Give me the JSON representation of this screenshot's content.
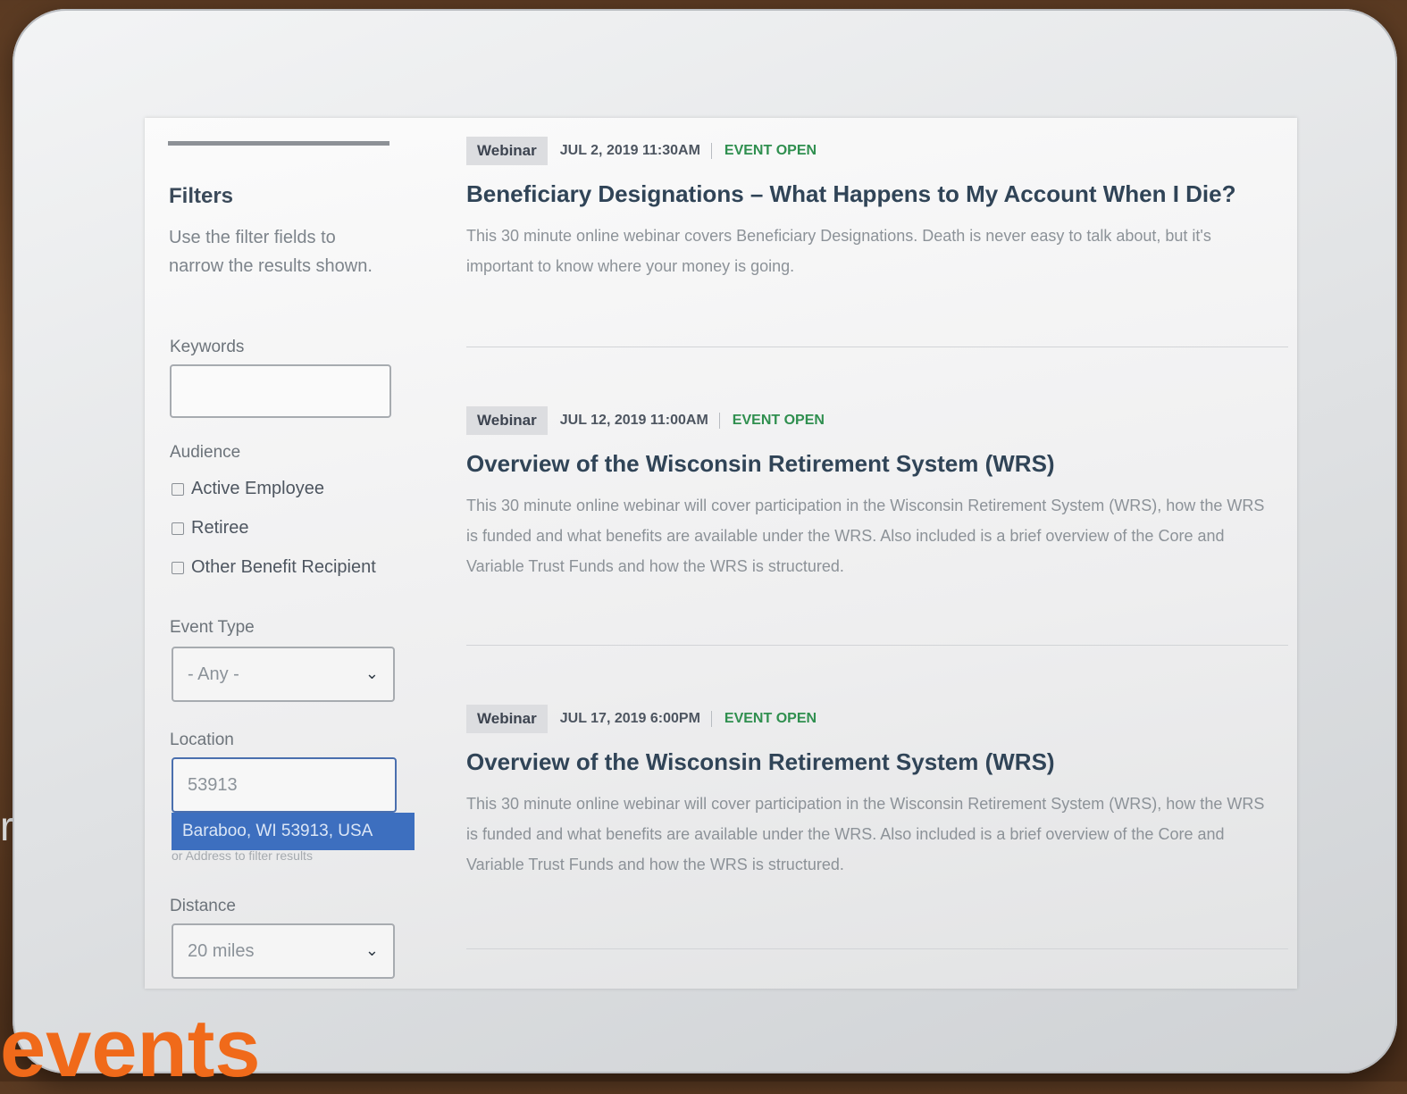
{
  "background": {
    "fragment_small": "rs",
    "fragment_large": "events",
    "accent_color": "#f06a1a"
  },
  "sidebar": {
    "title": "Filters",
    "description": "Use the filter fields to narrow the results shown.",
    "keywords": {
      "label": "Keywords",
      "value": ""
    },
    "audience": {
      "label": "Audience",
      "options": [
        "Active Employee",
        "Retiree",
        "Other Benefit Recipient"
      ]
    },
    "event_type": {
      "label": "Event Type",
      "selected": "- Any -"
    },
    "location": {
      "label": "Location",
      "value": "53913",
      "suggestion": "Baraboo, WI 53913, USA",
      "hint": "or Address to filter results"
    },
    "distance": {
      "label": "Distance",
      "selected": "20 miles"
    }
  },
  "events": [
    {
      "type": "Webinar",
      "date": "JUL 2, 2019 11:30AM",
      "status": "EVENT OPEN",
      "title": "Beneficiary Designations – What Happens to My Account When I Die?",
      "description": "This 30 minute online webinar covers Beneficiary Designations. Death is never easy to talk about, but it's important to know where your money is going."
    },
    {
      "type": "Webinar",
      "date": "JUL 12, 2019 11:00AM",
      "status": "EVENT OPEN",
      "title": "Overview of the Wisconsin Retirement System (WRS)",
      "description": "This 30 minute online webinar will cover participation in the Wisconsin Retirement System (WRS), how the WRS is funded and what benefits are available under the WRS. Also included is a brief overview of the Core and Variable Trust Funds and how the WRS is structured."
    },
    {
      "type": "Webinar",
      "date": "JUL 17, 2019 6:00PM",
      "status": "EVENT OPEN",
      "title": "Overview of the Wisconsin Retirement System (WRS)",
      "description": "This 30 minute online webinar will cover participation in the Wisconsin Retirement System (WRS), how the WRS is funded and what benefits are available under the WRS. Also included is a brief overview of the Core and Variable Trust Funds and how the WRS is structured."
    }
  ]
}
